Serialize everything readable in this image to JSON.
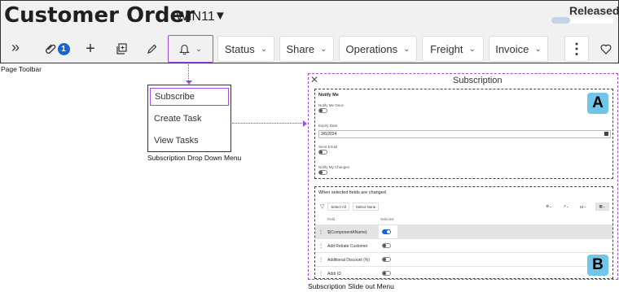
{
  "header": {
    "title": "Customer Order",
    "order_id": "WIN11",
    "status": "Released",
    "progress_fraction": 0.3
  },
  "toolbar": {
    "expand_icon": "chevron-double-right-icon",
    "attachments_count": "1",
    "add_icon": "plus-icon",
    "duplicate_icon": "duplicate-icon",
    "edit_icon": "pencil-icon",
    "bell_icon": "bell-icon",
    "status_label": "Status",
    "share_label": "Share",
    "operations_label": "Operations",
    "freight_label": "Freight",
    "invoice_label": "Invoice",
    "more_icon": "kebab-icon",
    "favorite_icon": "heart-icon"
  },
  "captions": {
    "toolbar": "Page Toolbar",
    "dropdown": "Subscription Drop Down Menu",
    "panel": "Subscription Slide out Menu"
  },
  "dropdown": {
    "items": [
      "Subscribe",
      "Create Task",
      "View Tasks"
    ]
  },
  "panel": {
    "title": "Subscription",
    "marker_a": "A",
    "marker_b": "B",
    "section_a": {
      "heading": "Notify Me",
      "notify_once_label": "Notify Me Once",
      "expiry_label": "Expiry Date",
      "expiry_value": "3/6/2024",
      "send_email_label": "Send Email",
      "notify_changes_label": "Notify My Changes"
    },
    "section_b": {
      "heading": "When selected fields are changed",
      "select_all": "Select All",
      "select_none": "Select None",
      "page_size": "24",
      "col_field": "Field",
      "col_selected": "Selected",
      "rows": [
        {
          "name": "${ComponentAName}",
          "selected": true
        },
        {
          "name": "Add Rebate Customer",
          "selected": false
        },
        {
          "name": "Additional Discount (%)",
          "selected": false
        },
        {
          "name": "Addr ID",
          "selected": false
        }
      ]
    }
  },
  "colors": {
    "highlight": "#a14be6",
    "badge": "#1a63d6",
    "marker": "#70c6e8"
  }
}
